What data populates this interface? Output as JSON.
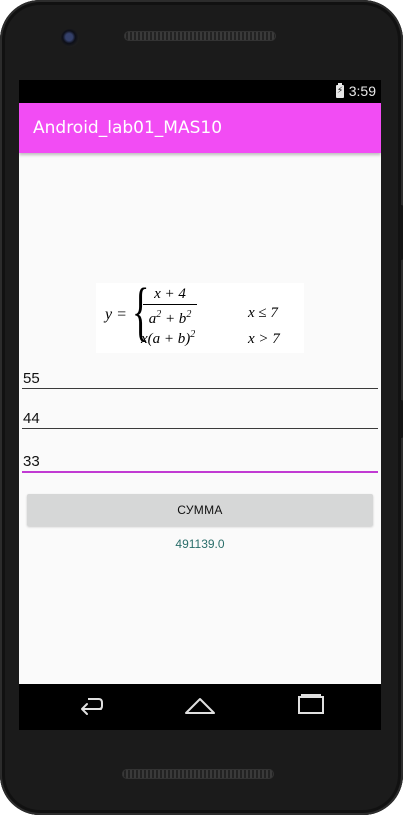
{
  "statusbar": {
    "time": "3:59"
  },
  "app": {
    "title": "Android_lab01_MAS10"
  },
  "formula": {
    "lhs": "y =",
    "numerator": "x + 4",
    "case1_condition": "x ≤ 7",
    "case2_expression": "x(a + b)",
    "case2_condition": "x > 7"
  },
  "inputs": [
    {
      "value": "55"
    },
    {
      "value": "44"
    },
    {
      "value": "33"
    }
  ],
  "button": {
    "label": "СУММА"
  },
  "result": {
    "text": "491139.0"
  },
  "colors": {
    "appbar": "#f24cf4",
    "focus_underline": "#c13ad3",
    "result_text": "#2a6e6a"
  }
}
